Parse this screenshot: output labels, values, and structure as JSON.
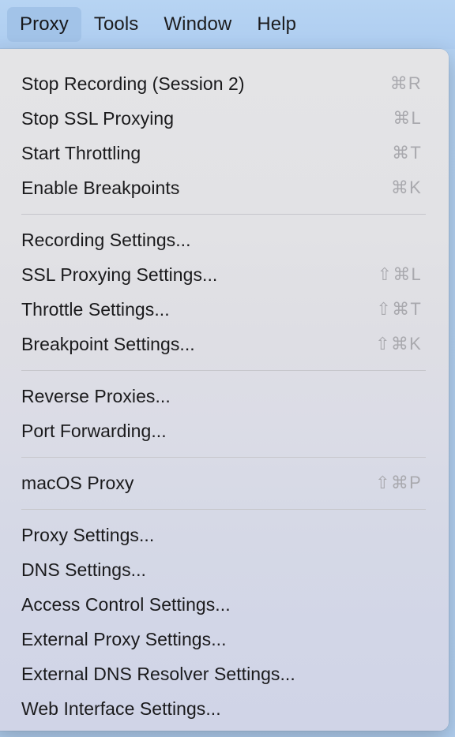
{
  "menubar": {
    "items": [
      {
        "label": "Proxy",
        "active": true
      },
      {
        "label": "Tools",
        "active": false
      },
      {
        "label": "Window",
        "active": false
      },
      {
        "label": "Help",
        "active": false
      }
    ]
  },
  "menu": {
    "title": "Proxy",
    "groups": [
      {
        "items": [
          {
            "label": "Stop Recording (Session 2)",
            "shortcut": "⌘R"
          },
          {
            "label": "Stop SSL Proxying",
            "shortcut": "⌘L"
          },
          {
            "label": "Start Throttling",
            "shortcut": "⌘T"
          },
          {
            "label": "Enable Breakpoints",
            "shortcut": "⌘K"
          }
        ]
      },
      {
        "items": [
          {
            "label": "Recording Settings...",
            "shortcut": ""
          },
          {
            "label": "SSL Proxying Settings...",
            "shortcut": "⇧⌘L"
          },
          {
            "label": "Throttle Settings...",
            "shortcut": "⇧⌘T"
          },
          {
            "label": "Breakpoint Settings...",
            "shortcut": "⇧⌘K"
          }
        ]
      },
      {
        "items": [
          {
            "label": "Reverse Proxies...",
            "shortcut": ""
          },
          {
            "label": "Port Forwarding...",
            "shortcut": ""
          }
        ]
      },
      {
        "items": [
          {
            "label": "macOS Proxy",
            "shortcut": "⇧⌘P"
          }
        ]
      },
      {
        "items": [
          {
            "label": "Proxy Settings...",
            "shortcut": ""
          },
          {
            "label": "DNS Settings...",
            "shortcut": ""
          },
          {
            "label": "Access Control Settings...",
            "shortcut": ""
          },
          {
            "label": "External Proxy Settings...",
            "shortcut": ""
          },
          {
            "label": "External DNS Resolver Settings...",
            "shortcut": ""
          },
          {
            "label": "Web Interface Settings...",
            "shortcut": ""
          }
        ]
      }
    ]
  },
  "colors": {
    "menubar_bg": "#b4d2f2",
    "menubar_active": "#a2c3e8",
    "panel_top": "#e4e4e6",
    "panel_bottom": "#d0d4e7",
    "label_text": "#1a1a1c",
    "shortcut_text": "#a9a9ae",
    "separator": "#c6c6cb"
  }
}
